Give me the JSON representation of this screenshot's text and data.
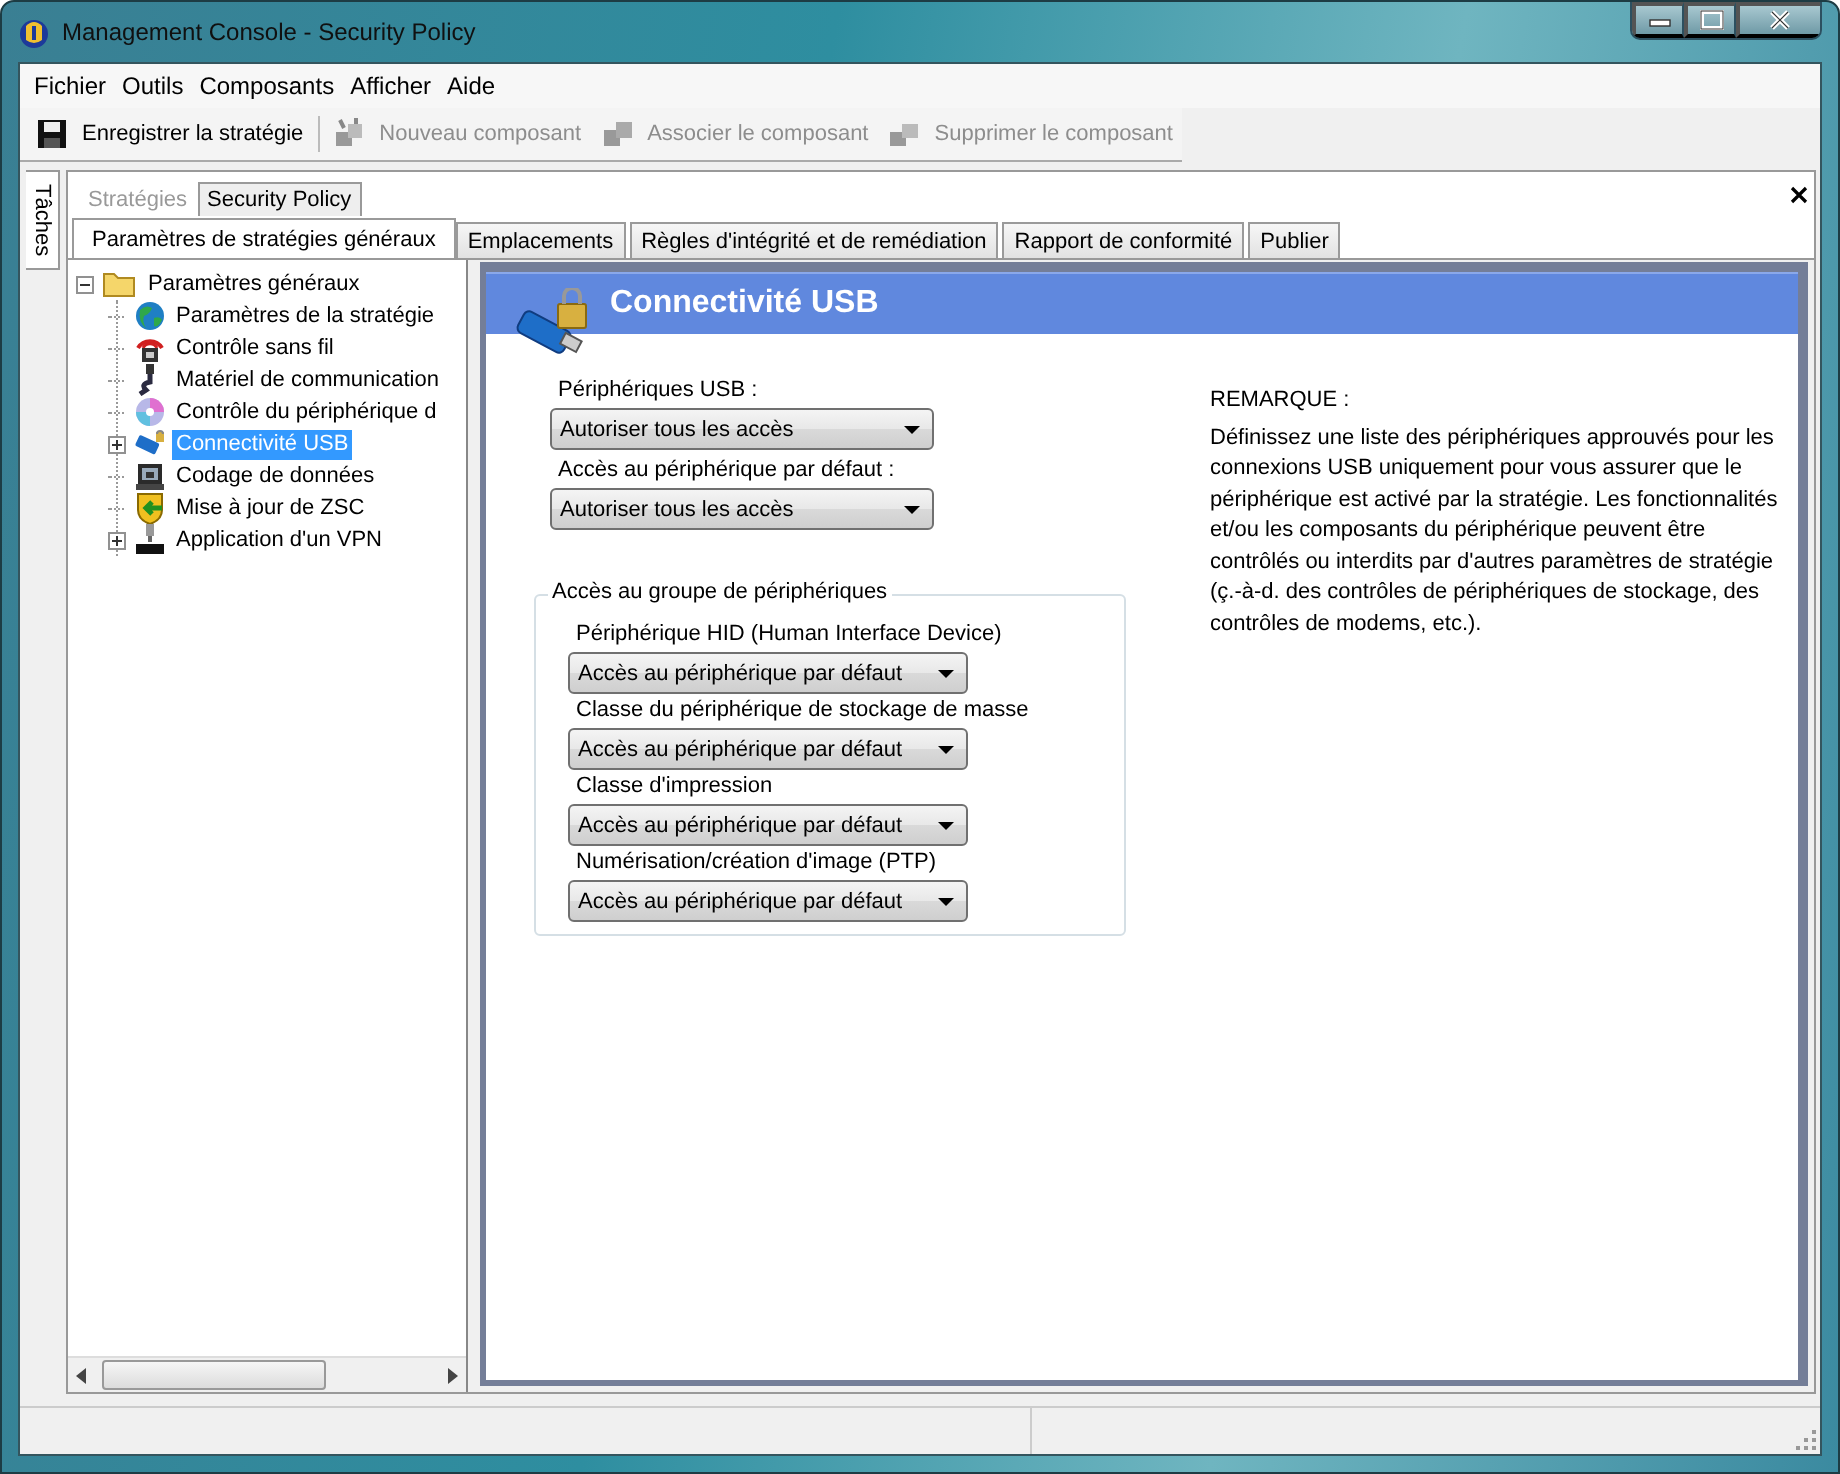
{
  "window": {
    "title": "Management Console  - Security Policy"
  },
  "menu": [
    "Fichier",
    "Outils",
    "Composants",
    "Afficher",
    "Aide"
  ],
  "toolbar": [
    {
      "label": "Enregistrer la stratégie",
      "kind": "save",
      "disabled": false
    },
    {
      "label": "Nouveau composant",
      "kind": "new",
      "disabled": true
    },
    {
      "label": "Associer le composant",
      "kind": "associate",
      "disabled": true
    },
    {
      "label": "Supprimer le composant",
      "kind": "delete",
      "disabled": true
    }
  ],
  "side_tab": {
    "label": "Tâches"
  },
  "doc_tabs": [
    {
      "label": "Stratégies",
      "selected": false
    },
    {
      "label": "Security Policy",
      "selected": true
    }
  ],
  "tabs": [
    {
      "label": "Paramètres de stratégies généraux",
      "selected": true
    },
    {
      "label": "Emplacements",
      "selected": false
    },
    {
      "label": "Règles d'intégrité et de remédiation",
      "selected": false
    },
    {
      "label": "Rapport de conformité",
      "selected": false
    },
    {
      "label": "Publier",
      "selected": false
    }
  ],
  "tree": {
    "label": "Paramètres généraux",
    "expanded": true,
    "children": [
      {
        "label": "Paramètres de la stratégie",
        "kind": "globe",
        "expandable": false,
        "selected": false
      },
      {
        "label": "Contrôle sans fil",
        "kind": "wireless",
        "expandable": false,
        "selected": false
      },
      {
        "label": "Matériel de communication",
        "kind": "plug",
        "expandable": false,
        "selected": false
      },
      {
        "label": "Contrôle du périphérique d",
        "kind": "disc",
        "expandable": false,
        "selected": false
      },
      {
        "label": "Connectivité USB",
        "kind": "usb",
        "expandable": true,
        "selected": true
      },
      {
        "label": "Codage de données",
        "kind": "lock",
        "expandable": false,
        "selected": false
      },
      {
        "label": "Mise à jour de ZSC",
        "kind": "update",
        "expandable": false,
        "selected": false
      },
      {
        "label": "Application d'un VPN",
        "kind": "vpn",
        "expandable": true,
        "selected": false
      }
    ]
  },
  "panel": {
    "title": "Connectivité USB",
    "fields": [
      {
        "label": "Périphériques USB :",
        "value": "Autoriser tous les accès"
      },
      {
        "label": "Accès au périphérique par défaut :",
        "value": "Autoriser tous les accès"
      }
    ],
    "group": {
      "title": "Accès au groupe de périphériques",
      "fields": [
        {
          "label": "Périphérique HID (Human Interface Device)",
          "value": "Accès au périphérique par défaut"
        },
        {
          "label": "Classe du périphérique de stockage de masse",
          "value": "Accès au périphérique par défaut"
        },
        {
          "label": "Classe d'impression",
          "value": "Accès au périphérique par défaut"
        },
        {
          "label": "Numérisation/création d'image (PTP)",
          "value": "Accès au périphérique par défaut"
        }
      ]
    },
    "note": {
      "title": "REMARQUE :",
      "text": "Définissez une liste des périphériques approuvés pour les connexions USB uniquement pour vous assurer que le périphérique est activé par la stratégie. Les fonctionnalités et/ou les composants du périphérique peuvent être contrôlés ou interdits par d'autres paramètres de stratégie (ç.-à-d. des contrôles de périphériques de stockage, des contrôles de modems, etc.)."
    }
  }
}
